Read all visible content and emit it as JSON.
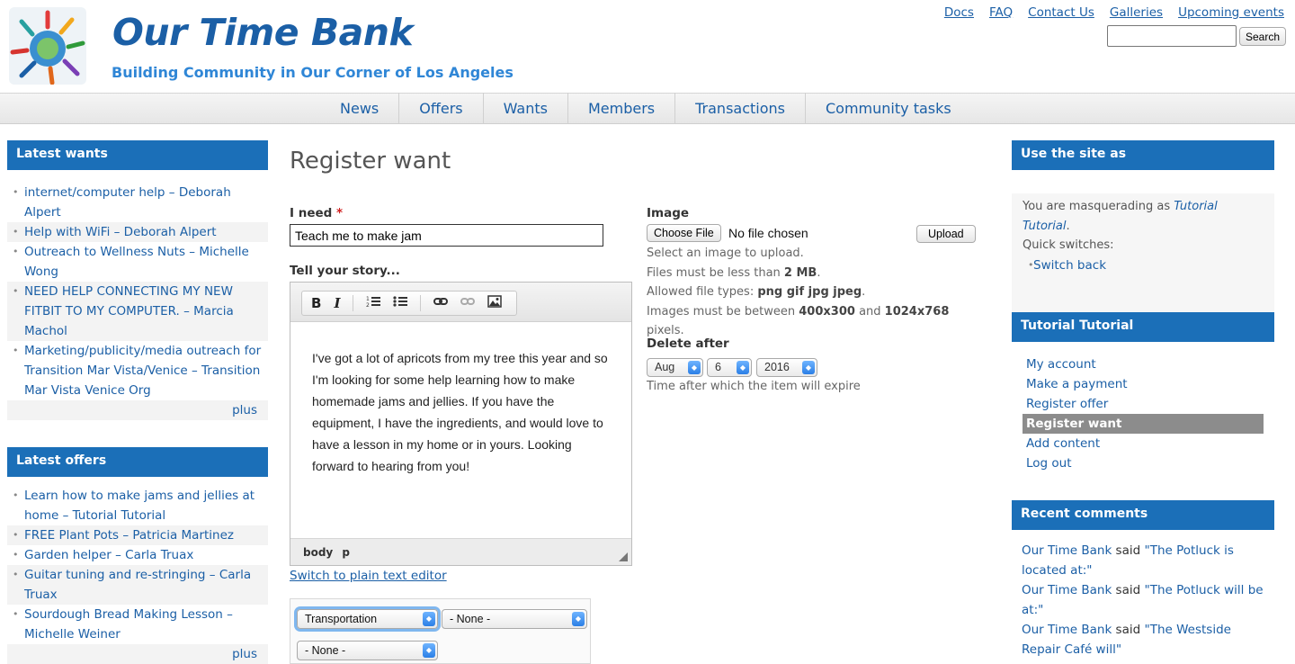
{
  "header": {
    "site_name": "Our Time Bank",
    "slogan": "Building Community in Our Corner of Los Angeles",
    "top_links": [
      "Docs",
      "FAQ",
      "Contact Us",
      "Galleries",
      "Upcoming events"
    ],
    "search_placeholder": "",
    "search_button": "Search"
  },
  "nav": [
    "News",
    "Offers",
    "Wants",
    "Members",
    "Transactions",
    "Community tasks"
  ],
  "latest_wants": {
    "title": "Latest wants",
    "items": [
      "internet/computer help – Deborah Alpert",
      "Help with WiFi – Deborah Alpert",
      "Outreach to Wellness Nuts – Michelle Wong",
      "NEED HELP CONNECTING MY NEW FITBIT TO MY COMPUTER. – Marcia Machol",
      "Marketing/publicity/media outreach for Transition Mar Vista/Venice – Transition Mar Vista Venice Org"
    ],
    "more": "plus"
  },
  "latest_offers": {
    "title": "Latest offers",
    "items": [
      "Learn how to make jams and jellies at home – Tutorial Tutorial",
      "FREE Plant Pots – Patricia Martinez",
      "Garden helper – Carla Truax",
      "Guitar tuning and re-stringing – Carla Truax",
      "Sourdough Bread Making Lesson – Michelle Weiner"
    ],
    "more": "plus"
  },
  "form": {
    "page_title": "Register want",
    "need_label": "I need",
    "required_mark": "*",
    "need_value": "Teach me to make jam",
    "story_label": "Tell your story...",
    "toolbar": {
      "bold": "B",
      "italic": "I"
    },
    "story_text": "I've got a lot of apricots from my tree this year and so I'm looking for some help learning how to make homemade jams and jellies.  If you have the equipment, I have the ingredients, and would love to have a lesson in my home or in yours. Looking forward to hearing from you!",
    "status_path": "body  p",
    "switch_editor": "Switch to plain text editor",
    "category_1": "Transportation",
    "category_2": "- None -",
    "category_3": "- None -",
    "image_label": "Image",
    "choose_file": "Choose File",
    "no_file": "No file chosen",
    "upload": "Upload",
    "image_help_1": "Select an image to upload.",
    "image_help_2_pre": "Files must be less than ",
    "image_help_2_val": "2 MB",
    "image_help_2_post": ".",
    "image_help_3_pre": "Allowed file types: ",
    "image_help_3_val": "png gif jpg jpeg",
    "image_help_3_post": ".",
    "image_help_4_pre": "Images must be between ",
    "image_help_4_min": "400x300",
    "image_help_4_mid": " and ",
    "image_help_4_max": "1024x768",
    "image_help_4_post": " pixels.",
    "delete_label": "Delete after",
    "delete_month": "Aug",
    "delete_day": "6",
    "delete_year": "2016",
    "delete_help": "Time after which the item will expire"
  },
  "use_site": {
    "title": "Use the site as",
    "text_pre": "You are masquerading as ",
    "user": "Tutorial Tutorial",
    "text_post": ".",
    "quick": "Quick switches:",
    "switch_back": "Switch back"
  },
  "tutorial_block": {
    "title": "Tutorial Tutorial",
    "items": [
      "My account",
      "Make a payment",
      "Register offer",
      "Register want",
      "Add content",
      "Log out"
    ],
    "active_index": 3
  },
  "recent_comments": {
    "title": "Recent comments",
    "items": [
      {
        "author": "Our Time Bank",
        "said": " said ",
        "text": "\"The Potluck is located at:\""
      },
      {
        "author": "Our Time Bank",
        "said": " said ",
        "text": "\"The Potluck will be at:\""
      },
      {
        "author": "Our Time Bank",
        "said": " said ",
        "text": "\"The Westside Repair Café will\""
      }
    ]
  },
  "colors": {
    "brand_blue": "#1b5fa6",
    "block_header": "#1b6fb8",
    "slogan": "#2f86d6",
    "active_menu": "#8c8c8c"
  },
  "icons": [
    "bold-icon",
    "italic-icon",
    "numbered-list-icon",
    "bullet-list-icon",
    "link-icon",
    "unlink-icon",
    "image-icon"
  ]
}
